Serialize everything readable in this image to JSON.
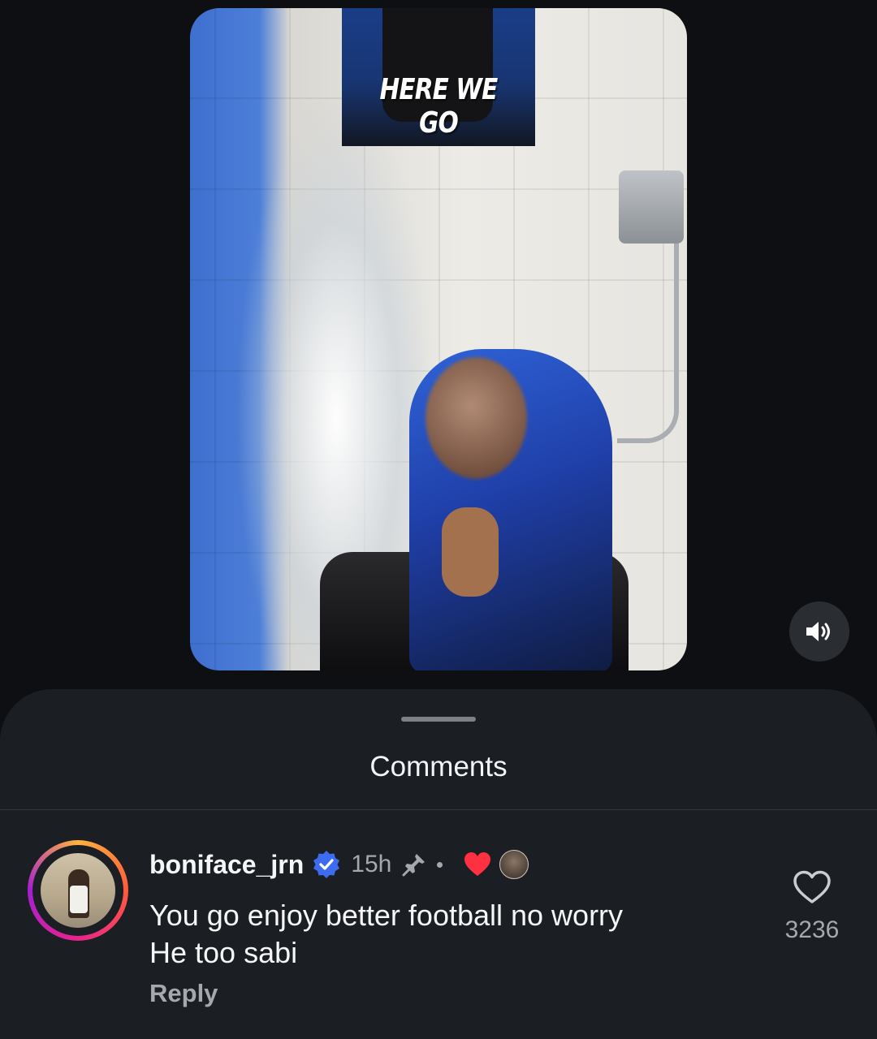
{
  "video": {
    "overlay_text": "HERE WE GO"
  },
  "sheet": {
    "title": "Comments"
  },
  "comment": {
    "username": "boniface_jrn",
    "time": "15h",
    "separator": "•",
    "text_line1": "You go enjoy better football no worry",
    "text_line2": "He too sabi",
    "reply_label": "Reply",
    "like_count": "3236"
  },
  "icons": {
    "sound": "speaker-icon",
    "verified": "verified-badge-icon",
    "pin": "pin-icon",
    "creator_liked": "heart-filled-icon",
    "like": "heart-outline-icon"
  },
  "colors": {
    "background": "#0d0f12",
    "sheet": "#1b1e22",
    "verified": "#3d6cf0",
    "heart": "#ff3040",
    "muted_text": "#a4a9ae"
  }
}
